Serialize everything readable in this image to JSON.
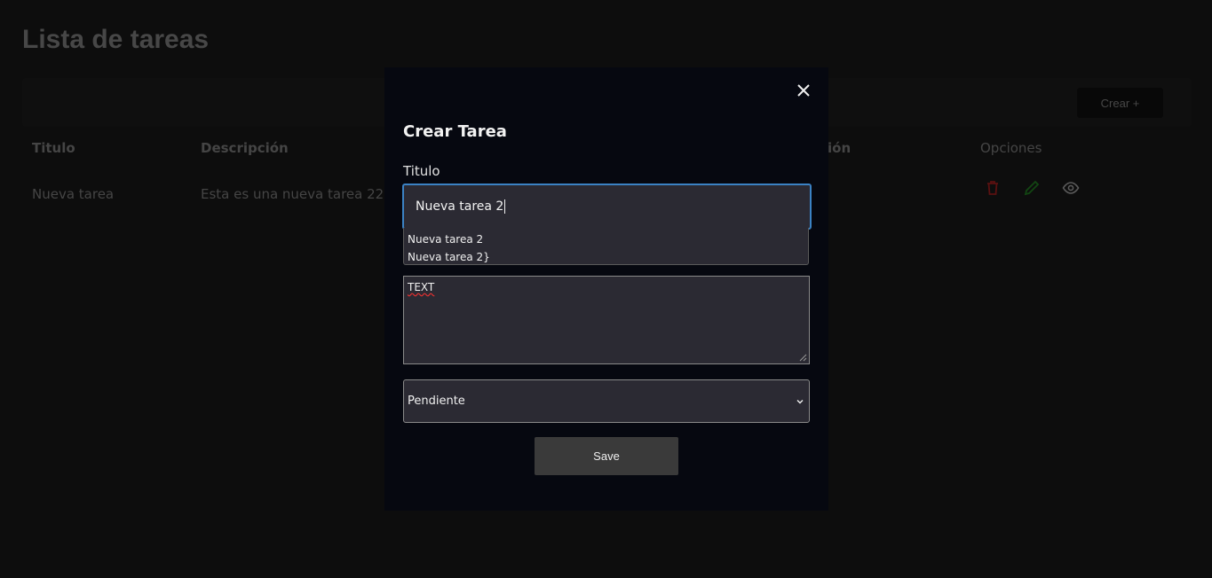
{
  "page": {
    "title": "Lista de tareas",
    "create_button": "Crear +",
    "columns": [
      "Titulo",
      "Descripción",
      "ión",
      "Opciones"
    ],
    "rows": [
      {
        "titulo": "Nueva tarea",
        "descripcion": "Esta es una nueva tarea 22"
      }
    ],
    "row_icons": [
      "trash-icon",
      "pencil-icon",
      "eye-icon"
    ],
    "colors": {
      "delete": "#8b1a1a",
      "edit": "#1d6b1d",
      "view": "#8a8a8a"
    }
  },
  "modal": {
    "title": "Crear Tarea",
    "titulo_label": "Titulo",
    "titulo_value": "Nueva tarea 2",
    "suggestions": [
      "Nueva tarea 2",
      "Nueva tarea 2}"
    ],
    "description_value": "TEXT",
    "status_value": "Pendiente",
    "save_label": "Save",
    "accent": "#3b82c4"
  }
}
